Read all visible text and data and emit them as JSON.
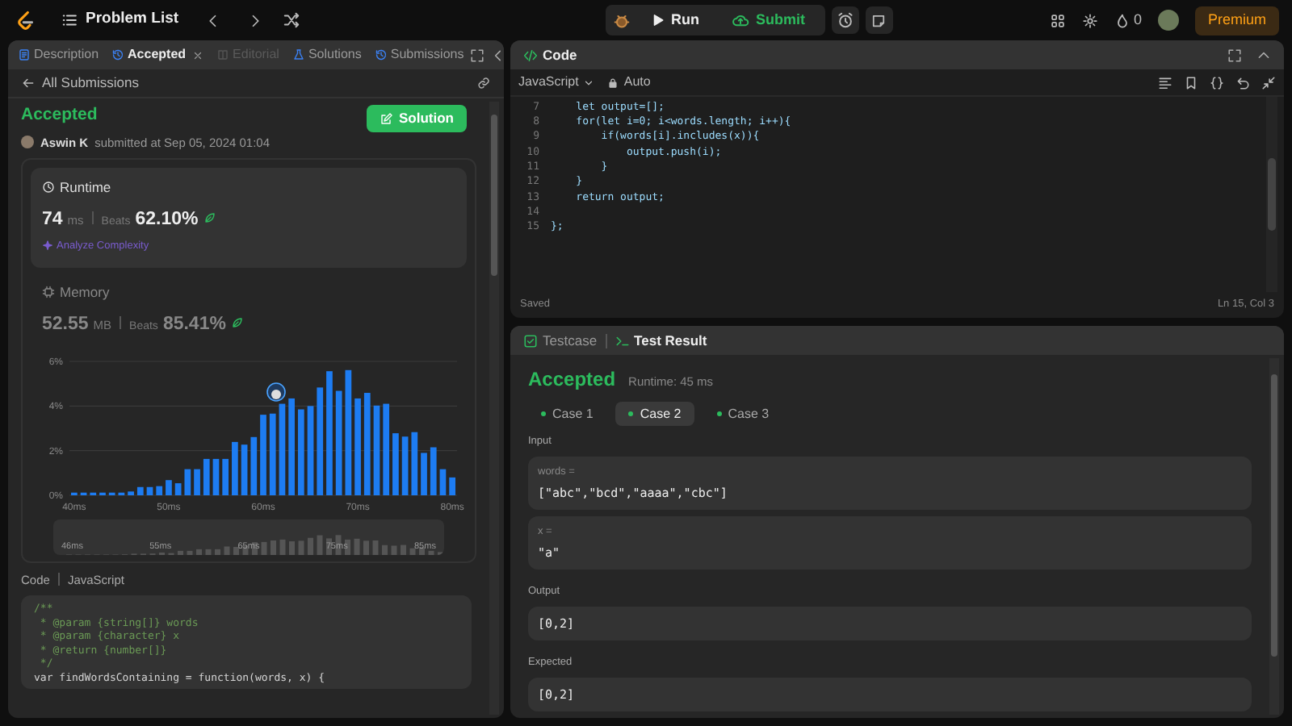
{
  "toolbar": {
    "title": "Problem List",
    "run": "Run",
    "submit": "Submit",
    "streak": "0",
    "premium": "Premium"
  },
  "left_panel": {
    "tabs": [
      {
        "label": "Description",
        "selected": false,
        "disabled": false
      },
      {
        "label": "Accepted",
        "selected": true,
        "disabled": false
      },
      {
        "label": "Editorial",
        "selected": false,
        "disabled": true
      },
      {
        "label": "Solutions",
        "selected": false,
        "disabled": false
      },
      {
        "label": "Submissions",
        "selected": false,
        "disabled": false
      }
    ],
    "back_link": "All Submissions",
    "result": {
      "status": "Accepted",
      "author": "Aswin K",
      "submitted": "submitted at Sep 05, 2024 01:04",
      "solution_button": "Solution"
    },
    "runtime": {
      "title": "Runtime",
      "value": "74",
      "unit": "ms",
      "beats_label": "Beats",
      "beats": "62.10%",
      "analyze": "Analyze Complexity",
      "selected": true
    },
    "memory": {
      "title": "Memory",
      "value": "52.55",
      "unit": "MB",
      "beats_label": "Beats",
      "beats": "85.41%",
      "selected": false
    },
    "chart_data": {
      "type": "bar",
      "x": [
        40,
        41,
        42,
        43,
        44,
        45,
        46,
        47,
        48,
        49,
        50,
        51,
        52,
        53,
        54,
        55,
        56,
        57,
        58,
        59,
        60,
        61,
        62,
        63,
        64,
        65,
        66,
        67,
        68,
        69,
        70,
        71,
        72,
        73,
        74,
        75,
        76,
        77,
        78,
        79,
        80
      ],
      "values": [
        0.12,
        0.12,
        0.12,
        0.12,
        0.12,
        0.12,
        0.17,
        0.37,
        0.37,
        0.41,
        0.68,
        0.54,
        1.17,
        1.17,
        1.63,
        1.63,
        1.63,
        2.39,
        2.27,
        2.61,
        3.61,
        3.66,
        4.1,
        4.34,
        3.85,
        4.0,
        4.83,
        5.56,
        4.68,
        5.61,
        4.34,
        4.59,
        4.02,
        4.1,
        2.78,
        2.63,
        2.83,
        1.9,
        2.15,
        1.17,
        0.8
      ],
      "xlim": [
        39.5,
        80.5
      ],
      "ylim": [
        0,
        6
      ],
      "xticks": [
        {
          "value": 40,
          "label": "40ms"
        },
        {
          "value": 50,
          "label": "50ms"
        },
        {
          "value": 60,
          "label": "60ms"
        },
        {
          "value": 70,
          "label": "70ms"
        },
        {
          "value": 80,
          "label": "80ms"
        }
      ],
      "yticks": [
        {
          "value": 0,
          "label": "0%"
        },
        {
          "value": 2,
          "label": "2%"
        },
        {
          "value": 4,
          "label": "4%"
        },
        {
          "value": 6,
          "label": "6%"
        }
      ]
    },
    "brush_labels": [
      "46ms",
      "55ms",
      "65ms",
      "75ms",
      "85ms"
    ],
    "code_header": {
      "label": "Code",
      "language": "JavaScript"
    },
    "code_lines": [
      "/**",
      " * @param {string[]} words",
      " * @param {character} x",
      " * @return {number[]}",
      " */",
      "var findWordsContaining = function(words, x) {"
    ]
  },
  "editor": {
    "title": "Code",
    "language": "JavaScript",
    "mode": "Auto",
    "lines": [
      {
        "number": "7",
        "code": "    let output=[];"
      },
      {
        "number": "8",
        "code": "    for(let i=0; i<words.length; i++){"
      },
      {
        "number": "9",
        "code": "        if(words[i].includes(x)){"
      },
      {
        "number": "10",
        "code": "            output.push(i);"
      },
      {
        "number": "11",
        "code": "        }"
      },
      {
        "number": "12",
        "code": "    }"
      },
      {
        "number": "13",
        "code": "    return output;"
      },
      {
        "number": "14"
      },
      {
        "number": "15",
        "code": "};"
      }
    ],
    "status": "Saved",
    "cursor": "Ln 15, Col 3"
  },
  "results": {
    "tabs": [
      {
        "label": "Testcase",
        "selected": false
      },
      {
        "label": "Test Result",
        "selected": true
      }
    ],
    "status": "Accepted",
    "runtime": "Runtime: 45 ms",
    "cases": [
      {
        "label": "Case 1",
        "selected": false,
        "passed": true
      },
      {
        "label": "Case 2",
        "selected": true,
        "passed": true
      },
      {
        "label": "Case 3",
        "selected": false,
        "passed": true
      }
    ],
    "input_label": "Input",
    "inputs": [
      {
        "name": "words =",
        "value": "[\"abc\",\"bcd\",\"aaaa\",\"cbc\"]"
      },
      {
        "name": "x =",
        "value": "\"a\""
      }
    ],
    "output_label": "Output",
    "output": "[0,2]",
    "expected_label": "Expected",
    "expected": "[0,2]"
  }
}
